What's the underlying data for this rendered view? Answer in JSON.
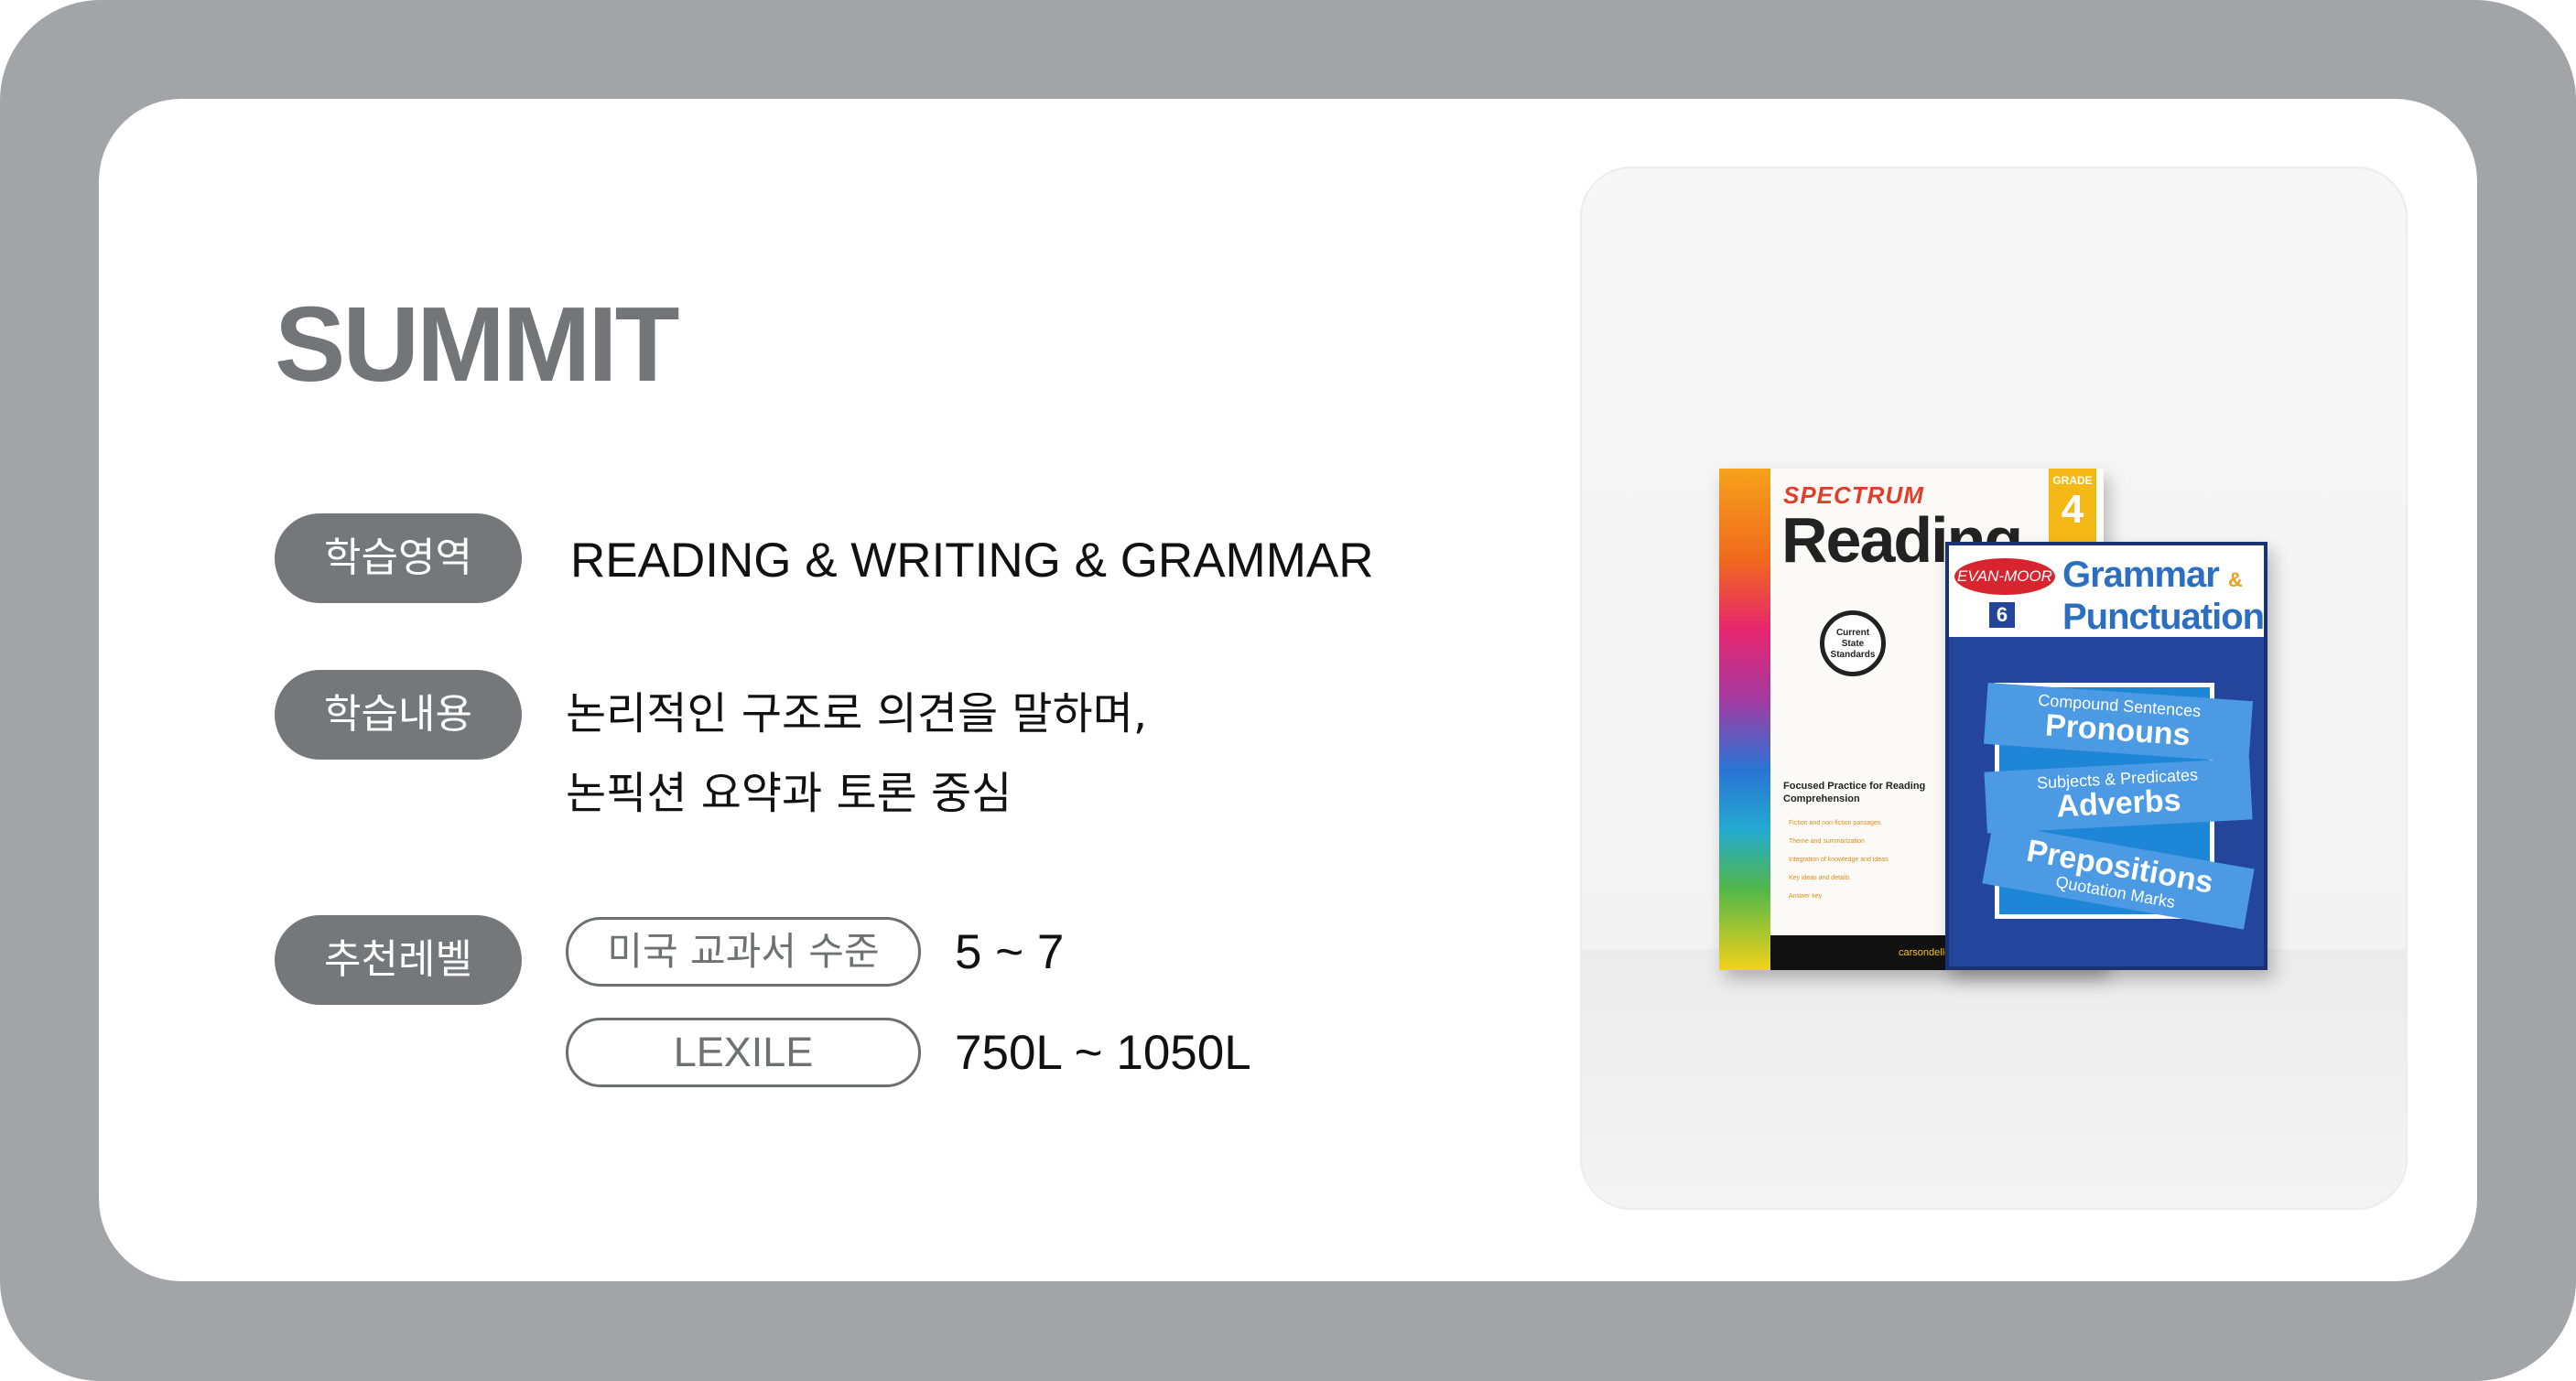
{
  "title": "SUMMIT",
  "rows": {
    "area": {
      "label": "학습영역",
      "value": "READING & WRITING & GRAMMAR"
    },
    "content": {
      "label": "학습내용",
      "line1": "논리적인 구조로 의견을 말하며,",
      "line2": "논픽션 요약과 토론 중심"
    },
    "level": {
      "label": "추천레벨",
      "us_label": "미국 교과서 수준",
      "us_value": "5 ~ 7",
      "lexile_label": "LEXILE",
      "lexile_value": "750L ~ 1050L"
    }
  },
  "books": {
    "spectrum": {
      "brand": "SPECTRUM",
      "title": "Reading",
      "grade_label": "GRADE",
      "grade": "4",
      "seal": "Current State Standards",
      "desc": "Focused Practice for Reading Comprehension",
      "bullets": [
        "Fiction and non-fiction passages",
        "Theme and summarization",
        "Integration of knowledge and ideas",
        "Key ideas and details",
        "Answer key"
      ],
      "footer": "carsondellosa.com"
    },
    "grammar": {
      "brand": "EVAN-MOOR",
      "grade": "6",
      "title1": "Grammar",
      "amp": "&",
      "title2": "Punctuation",
      "ribbon1_sm": "Compound Sentences",
      "ribbon1_lg": "Pronouns",
      "ribbon2_sm": "Subjects & Predicates",
      "ribbon2_lg": "Adverbs",
      "ribbon3_lg": "Prepositions",
      "ribbon3_sm": "Quotation Marks"
    }
  },
  "colors": {
    "frame": "#a3a4a8",
    "card": "#ffffff",
    "pill": "#76777b",
    "title": "#737579"
  }
}
